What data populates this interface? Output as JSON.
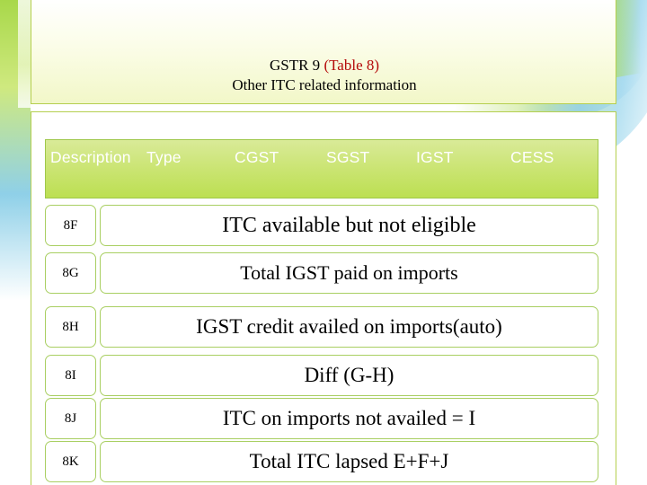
{
  "title": {
    "line1_prefix": "GSTR 9 ",
    "line1_highlight": "(Table 8)",
    "line2": "Other ITC related information"
  },
  "table": {
    "headers": [
      "Description",
      "Type",
      "CGST",
      "SGST",
      "IGST",
      "CESS"
    ],
    "rows": [
      {
        "code": "8F",
        "text": "ITC available but not eligible"
      },
      {
        "code": "8G",
        "text": "Total IGST paid on imports"
      },
      {
        "code": "8H",
        "text": "IGST credit availed  on imports(auto)"
      },
      {
        "code": "8I",
        "text": "Diff (G-H)"
      },
      {
        "code": "8J",
        "text": "ITC on imports not availed = I"
      },
      {
        "code": "8K",
        "text": "Total ITC lapsed E+F+J"
      }
    ]
  },
  "colors": {
    "header_bg": "#c9e46f",
    "header_text": "#ffffff",
    "panel_border": "#b5cf4f",
    "title_highlight": "#b40a0a",
    "row_border": "#a9cf62"
  }
}
